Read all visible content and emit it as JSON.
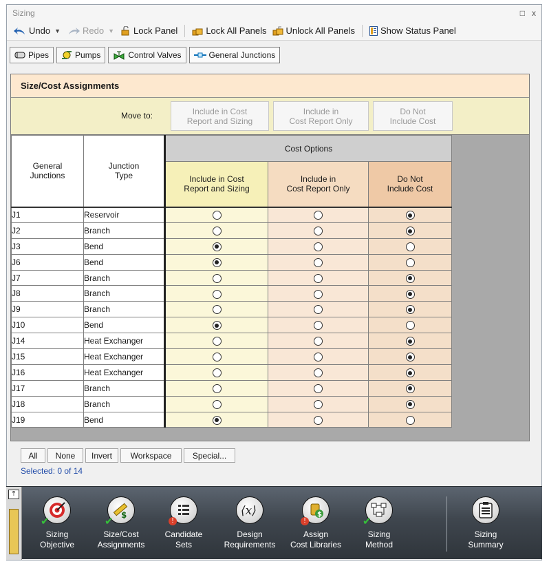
{
  "window": {
    "title": "Sizing",
    "restore": "□",
    "close": "x"
  },
  "toolbar": {
    "undo": "Undo",
    "redo": "Redo",
    "lock_panel": "Lock Panel",
    "lock_all": "Lock All Panels",
    "unlock_all": "Unlock All Panels",
    "show_status": "Show Status Panel"
  },
  "tabs": [
    "Pipes",
    "Pumps",
    "Control Valves",
    "General Junctions"
  ],
  "section": {
    "title": "Size/Cost Assignments"
  },
  "move_to": {
    "label": "Move to:",
    "buttons": [
      [
        "Include in Cost",
        "Report and Sizing"
      ],
      [
        "Include in",
        "Cost Report Only"
      ],
      [
        "Do Not",
        "Include Cost"
      ]
    ]
  },
  "table": {
    "header_junctions": [
      "General",
      "Junctions"
    ],
    "header_type": [
      "Junction",
      "Type"
    ],
    "header_cost_options": "Cost Options",
    "option_headers": [
      [
        "Include in Cost",
        "Report and Sizing"
      ],
      [
        "Include in",
        "Cost Report Only"
      ],
      [
        "Do Not",
        "Include Cost"
      ]
    ],
    "rows": [
      {
        "name": "J1",
        "type": "Reservoir",
        "selected": 2
      },
      {
        "name": "J2",
        "type": "Branch",
        "selected": 2
      },
      {
        "name": "J3",
        "type": "Bend",
        "selected": 0
      },
      {
        "name": "J6",
        "type": "Bend",
        "selected": 0
      },
      {
        "name": "J7",
        "type": "Branch",
        "selected": 2
      },
      {
        "name": "J8",
        "type": "Branch",
        "selected": 2
      },
      {
        "name": "J9",
        "type": "Branch",
        "selected": 2
      },
      {
        "name": "J10",
        "type": "Bend",
        "selected": 0
      },
      {
        "name": "J14",
        "type": "Heat Exchanger",
        "selected": 2
      },
      {
        "name": "J15",
        "type": "Heat Exchanger",
        "selected": 2
      },
      {
        "name": "J16",
        "type": "Heat Exchanger",
        "selected": 2
      },
      {
        "name": "J17",
        "type": "Branch",
        "selected": 2
      },
      {
        "name": "J18",
        "type": "Branch",
        "selected": 2
      },
      {
        "name": "J19",
        "type": "Bend",
        "selected": 0
      }
    ]
  },
  "selection": {
    "buttons": [
      "All",
      "None",
      "Invert",
      "Workspace",
      "Special..."
    ],
    "status": "Selected: 0 of 14"
  },
  "nav": [
    {
      "line1": "Sizing",
      "line2": "Objective",
      "icon": "target-icon"
    },
    {
      "line1": "Size/Cost",
      "line2": "Assignments",
      "icon": "ruler-dollar-icon"
    },
    {
      "line1": "Candidate",
      "line2": "Sets",
      "icon": "list-icon"
    },
    {
      "line1": "Design",
      "line2": "Requirements",
      "icon": "variable-x-icon"
    },
    {
      "line1": "Assign",
      "line2": "Cost Libraries",
      "icon": "coin-stack-icon"
    },
    {
      "line1": "Sizing",
      "line2": "Method",
      "icon": "flowchart-icon"
    },
    {
      "line1": "Sizing",
      "line2": "Summary",
      "icon": "clipboard-icon"
    }
  ]
}
